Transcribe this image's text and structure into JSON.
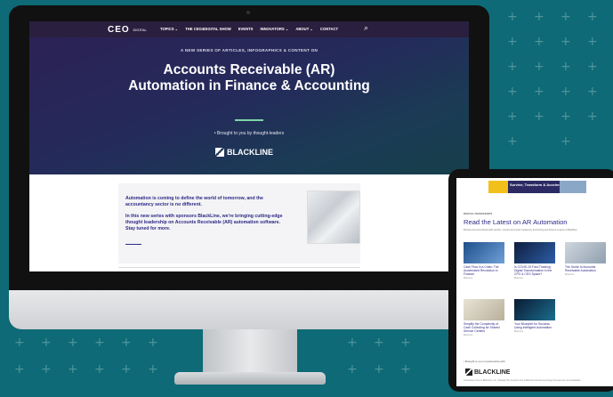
{
  "site": {
    "logo": "CEO",
    "logo_suffix": "DIGITAL",
    "nav": [
      "TOPICS ⌄",
      "THE CEO4DIGITAL SHOW",
      "EVENTS",
      "INNOVATORS ⌄",
      "ABOUT ⌄",
      "CONTACT"
    ],
    "search_icon": "search-icon"
  },
  "hero": {
    "kicker": "A NEW SERIES OF ARTICLES, INFOGRAPHICS & CONTENT ON",
    "title": "Accounts Receivable (AR) Automation in Finance & Accounting",
    "brought_by": "• Brought to you by thought-leaders",
    "sponsor": "BLACKLINE"
  },
  "intro": {
    "p1": "Automation is coming to define the world of tomorrow, and the accountancy sector is no different.",
    "p2": "In this new series with sponsors BlackLine, we're bringing cutting-edge thought leadership on Accounts Receivable (AR) automation software. Stay tuned for more."
  },
  "tablet": {
    "ad_text": "Survive, Transform & Accelerate",
    "section": "DIGITAL FINANCEOPS",
    "heading": "Read the Latest on AR Automation",
    "desc": "Browse Accounts Receivable articles, content and news curated by accounting and finance experts at Blackline.",
    "cards": [
      {
        "title": "Cash Flow in a Crisis: The Accelerated Revolution in Finance",
        "meta": "BlackLine"
      },
      {
        "title": "Is COVID-19 Fast-Tracking Digital Transformation in the CFO & CEO Space?",
        "meta": "BlackLine"
      },
      {
        "title": "The Guide to Accounts Receivable Automation",
        "meta": "BlackLine"
      },
      {
        "title": "Simplify the Complexity of Cash Collecting for Shared Service Centers",
        "meta": "BlackLine"
      },
      {
        "title": "Your Blueprint for Success Using Intelligent Automation",
        "meta": "BlackLine"
      }
    ],
    "brought": "• Brought to you in partnership with",
    "sponsor": "BLACKLINE",
    "footer": "Companies come to BlackLine, Inc. (Nasdaq: BL) because their traditional manual accounting processes are not sustainable."
  },
  "colors": {
    "background": "#0d6a76",
    "nav": "#2a1f3e",
    "accent": "#7ed3a6",
    "brand_text": "#2f2a86"
  }
}
